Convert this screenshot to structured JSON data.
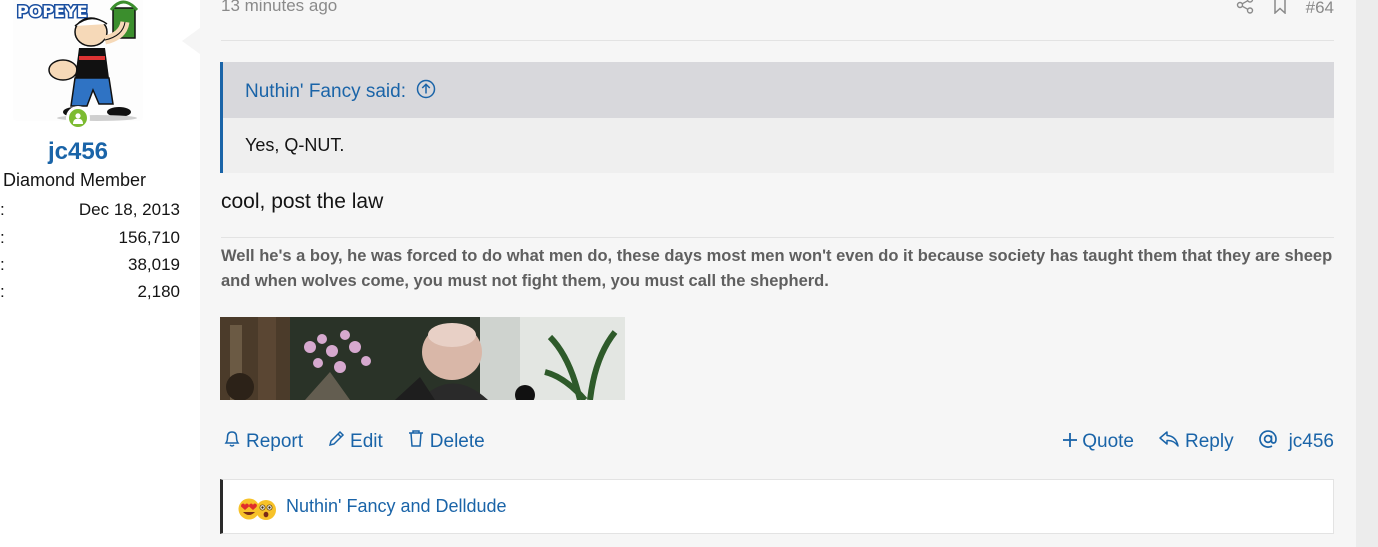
{
  "user": {
    "avatar_label": "POPEYE",
    "username": "jc456",
    "title": "Diamond Member",
    "stats": [
      {
        "key": ":",
        "value": "Dec 18, 2013"
      },
      {
        "key": ":",
        "value": "156,710"
      },
      {
        "key": ":",
        "value": "38,019"
      },
      {
        "key": ":",
        "value": "2,180"
      }
    ],
    "online_color": "#7cbb31"
  },
  "post": {
    "time": "13 minutes ago",
    "number": "#64",
    "quote": {
      "author": "Nuthin' Fancy said:",
      "body": "Yes, Q-NUT."
    },
    "message": "cool, post the law",
    "signature": "Well he's a boy, he was forced to do what men do, these days most men won't even do it because society has taught them that they are sheep and when wolves come, you must not fight them, you must call the shepherd."
  },
  "actions": {
    "report": "Report",
    "edit": "Edit",
    "delete": "Delete",
    "quote": "Quote",
    "reply": "Reply",
    "mention": "jc456"
  },
  "reactions": {
    "text": "Nuthin' Fancy and Delldude",
    "icons": [
      "heart-eyes-icon",
      "astonished-icon"
    ]
  },
  "colors": {
    "accent": "#1a64a8",
    "online": "#7cbb31"
  }
}
